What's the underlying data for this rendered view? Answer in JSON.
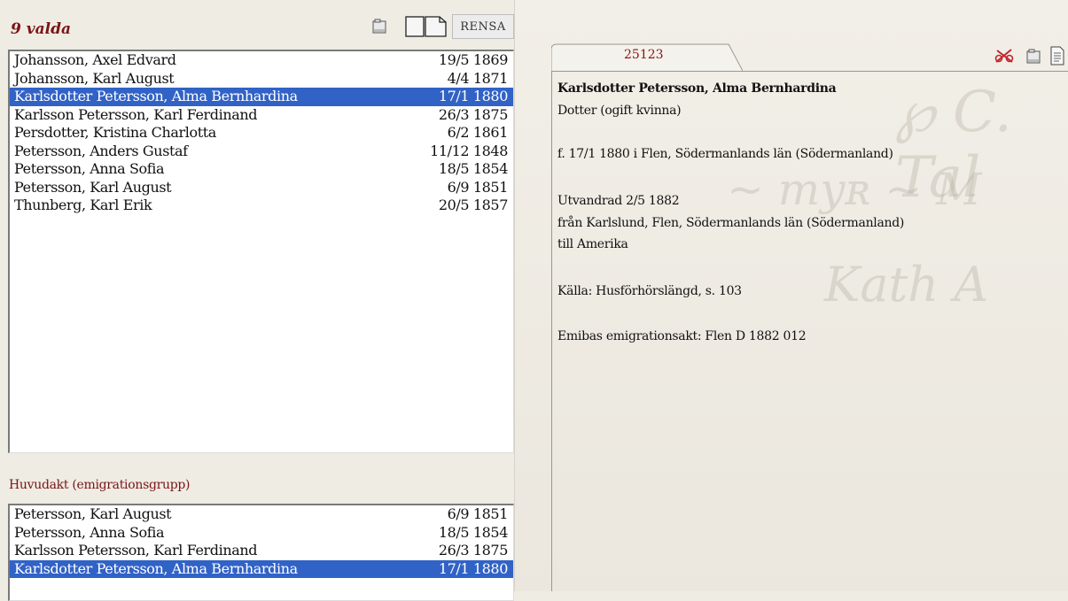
{
  "left": {
    "selected_title": "9 valda",
    "rensa_label": "RENSA",
    "selected_list": [
      {
        "name": "Johansson, Axel Edvard",
        "date": "19/5 1869",
        "selected": false
      },
      {
        "name": "Johansson, Karl August",
        "date": "4/4 1871",
        "selected": false
      },
      {
        "name": "Karlsdotter Petersson, Alma Bernhardina",
        "date": "17/1 1880",
        "selected": true
      },
      {
        "name": "Karlsson Petersson, Karl Ferdinand",
        "date": "26/3 1875",
        "selected": false
      },
      {
        "name": "Persdotter, Kristina Charlotta",
        "date": "6/2 1861",
        "selected": false
      },
      {
        "name": "Petersson, Anders Gustaf",
        "date": "11/12 1848",
        "selected": false
      },
      {
        "name": "Petersson, Anna Sofia",
        "date": "18/5 1854",
        "selected": false
      },
      {
        "name": "Petersson, Karl August",
        "date": "6/9 1851",
        "selected": false
      },
      {
        "name": "Thunberg, Karl Erik",
        "date": "20/5 1857",
        "selected": false
      }
    ],
    "group_label": "Huvudakt (emigrationsgrupp)",
    "group_list": [
      {
        "name": "Petersson, Karl August",
        "date": "6/9 1851",
        "selected": false
      },
      {
        "name": "Petersson, Anna Sofia",
        "date": "18/5 1854",
        "selected": false
      },
      {
        "name": "Karlsson Petersson, Karl Ferdinand",
        "date": "26/3 1875",
        "selected": false
      },
      {
        "name": "Karlsdotter Petersson, Alma Bernhardina",
        "date": "17/1 1880",
        "selected": true
      }
    ]
  },
  "right": {
    "tab_label": "25123",
    "person_name": "Karlsdotter Petersson, Alma Bernhardina",
    "role": "Dotter (ogift kvinna)",
    "birth": "f. 17/1 1880 i Flen, Södermanlands län (Södermanland)",
    "emigrated": "Utvandrad 2/5 1882",
    "from": "från Karlslund, Flen, Södermanlands län (Södermanland)",
    "to": "till Amerika",
    "source": "Källa: Husförhörslängd, s. 103",
    "emibas": "Emibas emigrationsakt: Flen D 1882 012"
  },
  "colors": {
    "accent_red": "#7a1414",
    "selection_blue": "#3162c6"
  },
  "icons": [
    "folder-icon",
    "book-icon",
    "unlink-icon",
    "document-icon"
  ]
}
